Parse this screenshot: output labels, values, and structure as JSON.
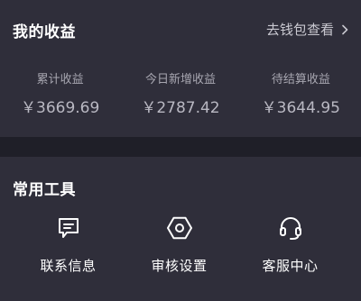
{
  "earnings": {
    "title": "我的收益",
    "wallet_link": "去钱包查看",
    "stats": [
      {
        "label": "累计收益",
        "value": "￥3669.69"
      },
      {
        "label": "今日新增收益",
        "value": "￥2787.42"
      },
      {
        "label": "待结算收益",
        "value": "￥3644.95"
      }
    ]
  },
  "tools": {
    "title": "常用工具",
    "items": [
      {
        "label": "联系信息",
        "icon": "message-icon"
      },
      {
        "label": "审核设置",
        "icon": "settings-icon"
      },
      {
        "label": "客服中心",
        "icon": "headset-icon"
      }
    ]
  }
}
